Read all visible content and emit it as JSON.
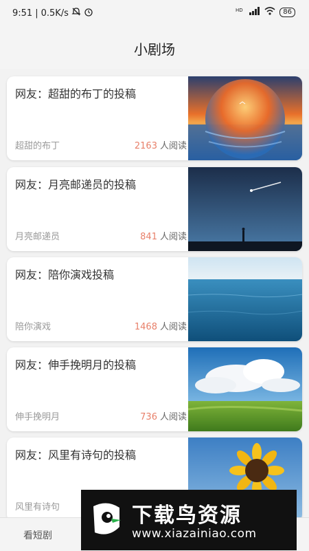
{
  "status_bar": {
    "time": "9:51",
    "network_speed": "0.5K/s",
    "battery": "86",
    "icons": [
      "mute-icon",
      "alarm-icon",
      "hd-icon",
      "signal-icon",
      "wifi-icon",
      "battery-icon"
    ]
  },
  "header": {
    "title": "小剧场"
  },
  "cards": [
    {
      "title": "网友：超甜的布丁的投稿",
      "author": "超甜的布丁",
      "reads_count": "2163",
      "reads_label": "人阅读",
      "image": "sunset-sphere"
    },
    {
      "title": "网友：月亮邮递员的投稿",
      "author": "月亮邮递员",
      "reads_count": "841",
      "reads_label": "人阅读",
      "image": "meteor-night"
    },
    {
      "title": "网友：陪你演戏投稿",
      "author": "陪你演戏",
      "reads_count": "1468",
      "reads_label": "人阅读",
      "image": "ocean"
    },
    {
      "title": "网友：伸手挽明月的投稿",
      "author": "伸手挽明月",
      "reads_count": "736",
      "reads_label": "人阅读",
      "image": "grassland-clouds"
    },
    {
      "title": "网友：风里有诗句的投稿",
      "author": "风里有诗句",
      "reads_count": "",
      "reads_label": "",
      "image": "sunflower-sky"
    }
  ],
  "bottom_tab": {
    "label": "看短剧"
  },
  "watermark": {
    "brand": "下载鸟资源",
    "url": "www.xiazainiao.com"
  },
  "colors": {
    "read_count": "#e8806a",
    "background": "#f2f2f2",
    "card": "#ffffff"
  }
}
